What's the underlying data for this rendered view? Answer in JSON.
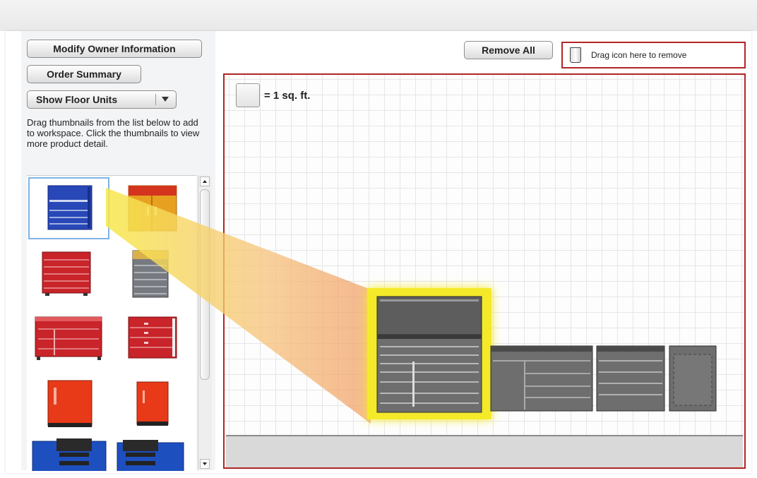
{
  "sidebar": {
    "modify_owner_label": "Modify Owner Information",
    "order_summary_label": "Order Summary",
    "floor_units_select": "Show Floor Units",
    "help_text": "Drag thumbnails from the list below to add to workspace. Click the thumbnails to view more product detail.",
    "thumbnails": [
      {
        "color": "#2848b8"
      },
      {
        "color": "#e8a020"
      },
      {
        "color": "#c8242a"
      },
      {
        "color": "#777a80"
      },
      {
        "color": "#c8242a"
      },
      {
        "color": "#c8242a"
      },
      {
        "color": "#e83a18"
      },
      {
        "color": "#e83a18"
      },
      {
        "color": "#1d4fbf"
      },
      {
        "color": "#1d4fbf"
      }
    ]
  },
  "toolbar": {
    "remove_all_label": "Remove All",
    "drag_remove_text": "Drag icon here to remove"
  },
  "workspace": {
    "legend_text": "= 1 sq. ft."
  },
  "colors": {
    "border_accent": "#b32525",
    "highlight": "#f4ea2a",
    "unit_gray": "#6e6e6e"
  }
}
